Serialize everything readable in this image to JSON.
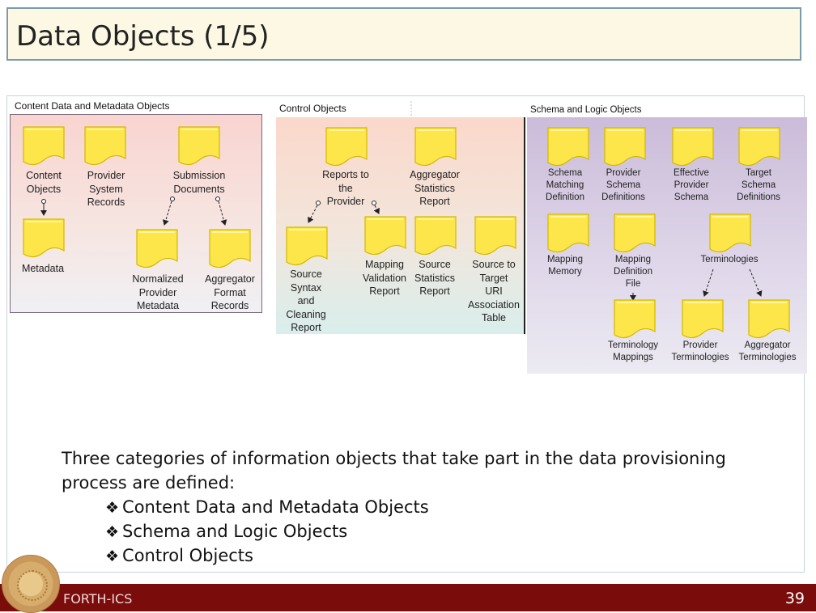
{
  "slide": {
    "title": "Data Objects (1/5)",
    "page_number": "39"
  },
  "footer": {
    "org": "FORTH-ICS"
  },
  "diagram": {
    "content_section_title": "Content Data and Metadata Objects",
    "control_section_title": "Control Objects",
    "schema_section_title": "Schema and Logic Objects",
    "content_labels": {
      "content_objects": "Content\nObjects",
      "provider_system_records": "Provider\nSystem\nRecords",
      "submission_documents": "Submission\nDocuments",
      "metadata": "Metadata",
      "normalized_provider_metadata": "Normalized\nProvider\nMetadata",
      "aggregator_format_records": "Aggregator\nFormat\nRecords"
    },
    "control_labels": {
      "reports_to_provider": "Reports to\nthe\nProvider",
      "aggregator_statistics_report": "Aggregator\nStatistics\nReport",
      "source_syntax_cleaning_report": "Source\nSyntax\nand\nCleaning\nReport",
      "mapping_validation_report": "Mapping\nValidation\nReport",
      "source_statistics_report": "Source\nStatistics\nReport",
      "source_target_uri_table": "Source to\nTarget\nURI\nAssociation\nTable"
    },
    "schema_labels": {
      "schema_matching_definition": "Schema\nMatching\nDefinition",
      "provider_schema_definitions": "Provider\nSchema\nDefinitions",
      "effective_provider_schema": "Effective\nProvider\nSchema",
      "target_schema_definitions": "Target\nSchema\nDefinitions",
      "mapping_memory": "Mapping\nMemory",
      "mapping_definition_file": "Mapping\nDefinition\nFile",
      "terminologies": "Terminologies",
      "terminology_mappings": "Terminology\nMappings",
      "provider_terminologies": "Provider\nTerminologies",
      "aggregator_terminologies": "Aggregator\nTerminologies"
    },
    "colors": {
      "document_fill": "#fce64a",
      "document_stroke": "#d4b800"
    }
  },
  "body": {
    "intro_line1": "Three categories of information objects that take part in the data provisioning",
    "intro_line2": "process are defined:",
    "bullet_glyph": "❖",
    "bullets": [
      "Content Data and Metadata Objects",
      "Schema and Logic Objects",
      "Control Objects"
    ]
  }
}
